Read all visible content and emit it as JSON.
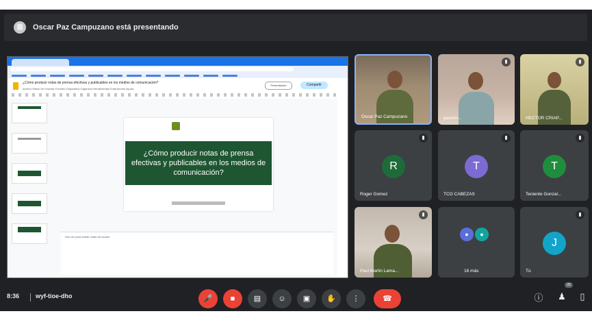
{
  "top_bar": {
    "presenter_text": "Oscar Paz Campuzano está presentando"
  },
  "shared_screen": {
    "browser_tab": "",
    "url": "",
    "doc_title": "¿Cómo producir notas de prensa efectivas y publicables en los medios de comunicación?",
    "doc_menu": "Archivo  Editar  Ver  Insertar  Formato  Diapositiva  Organizar  Herramientas  Extensiones  Ayuda",
    "present_label": "Presentación",
    "share_label": "Compartir",
    "slide_title": "¿Cómo producir notas de prensa efectivas y publicables en los medios de comunicación?",
    "notes_placeholder": "Haz clic para añadir notas del orador",
    "slide_colors": {
      "title_bg": "#1e5631"
    }
  },
  "participants": [
    {
      "name": "Oscar Paz Campuzano",
      "type": "camera",
      "active": true
    },
    {
      "name": "yasmín...",
      "type": "camera"
    },
    {
      "name": "HECTOR CRIAP...",
      "type": "camera"
    },
    {
      "name": "Roger Gomez",
      "type": "avatar",
      "initial": "R",
      "color": "#1e6b3a"
    },
    {
      "name": "TCO CABEZAS",
      "type": "avatar",
      "initial": "T",
      "color": "#7b6bd2"
    },
    {
      "name": "Teniente Gonzal...",
      "type": "avatar",
      "initial": "T",
      "color": "#1e8e3e"
    },
    {
      "name": "Paul Martin Lama...",
      "type": "camera"
    },
    {
      "name": "16 más",
      "type": "group",
      "count": 16
    },
    {
      "name": "Tú",
      "type": "avatar",
      "initial": "J",
      "color": "#12a4c9"
    }
  ],
  "bottom_bar": {
    "time": "8:36",
    "meeting_code": "wyf-tioe-dho",
    "controls": [
      {
        "id": "mic",
        "icon": "mic-off-icon",
        "state": "off"
      },
      {
        "id": "cam",
        "icon": "camera-off-icon",
        "state": "off"
      },
      {
        "id": "captions",
        "icon": "captions-icon",
        "state": "normal"
      },
      {
        "id": "emoji",
        "icon": "emoji-icon",
        "state": "normal"
      },
      {
        "id": "present",
        "icon": "present-icon",
        "state": "normal"
      },
      {
        "id": "raise_hand",
        "icon": "hand-icon",
        "state": "normal"
      },
      {
        "id": "more",
        "icon": "more-vert-icon",
        "state": "normal"
      },
      {
        "id": "leave",
        "icon": "hangup-icon",
        "state": "danger"
      }
    ],
    "participants_badge": "25"
  },
  "colors": {
    "meet_bg": "#202124",
    "tile_bg": "#3c4043",
    "danger": "#ea4335",
    "accent_blue": "#8ab4f8"
  }
}
